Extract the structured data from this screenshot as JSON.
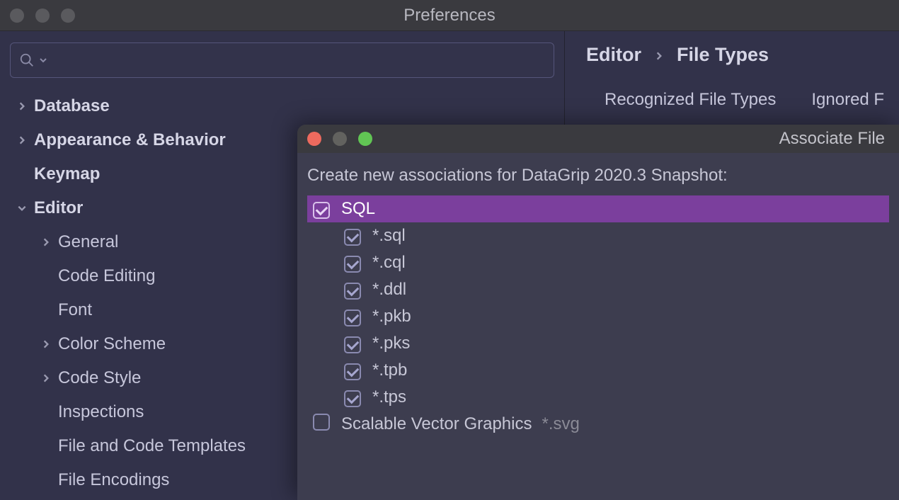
{
  "window": {
    "title": "Preferences"
  },
  "search": {
    "placeholder": ""
  },
  "sidebar": {
    "items": [
      {
        "label": "Database",
        "bold": true,
        "arrow": "right"
      },
      {
        "label": "Appearance & Behavior",
        "bold": true,
        "arrow": "right"
      },
      {
        "label": "Keymap",
        "bold": true,
        "arrow": "none"
      },
      {
        "label": "Editor",
        "bold": true,
        "arrow": "down",
        "children": [
          {
            "label": "General",
            "arrow": "right"
          },
          {
            "label": "Code Editing",
            "arrow": "none"
          },
          {
            "label": "Font",
            "arrow": "none"
          },
          {
            "label": "Color Scheme",
            "arrow": "right"
          },
          {
            "label": "Code Style",
            "arrow": "right"
          },
          {
            "label": "Inspections",
            "arrow": "none"
          },
          {
            "label": "File and Code Templates",
            "arrow": "none"
          },
          {
            "label": "File Encodings",
            "arrow": "none"
          }
        ]
      }
    ]
  },
  "breadcrumb": {
    "root": "Editor",
    "leaf": "File Types"
  },
  "tabs": [
    {
      "label": "Recognized File Types"
    },
    {
      "label": "Ignored F"
    }
  ],
  "dialog": {
    "title": "Associate File",
    "prompt": "Create new associations for DataGrip 2020.3 Snapshot:",
    "groups": [
      {
        "label": "SQL",
        "checked": true,
        "selected": true,
        "patterns": [
          {
            "label": "*.sql",
            "checked": true
          },
          {
            "label": "*.cql",
            "checked": true
          },
          {
            "label": "*.ddl",
            "checked": true
          },
          {
            "label": "*.pkb",
            "checked": true
          },
          {
            "label": "*.pks",
            "checked": true
          },
          {
            "label": "*.tpb",
            "checked": true
          },
          {
            "label": "*.tps",
            "checked": true
          }
        ]
      },
      {
        "label": "Scalable Vector Graphics",
        "checked": false,
        "hint": "*.svg"
      }
    ]
  }
}
